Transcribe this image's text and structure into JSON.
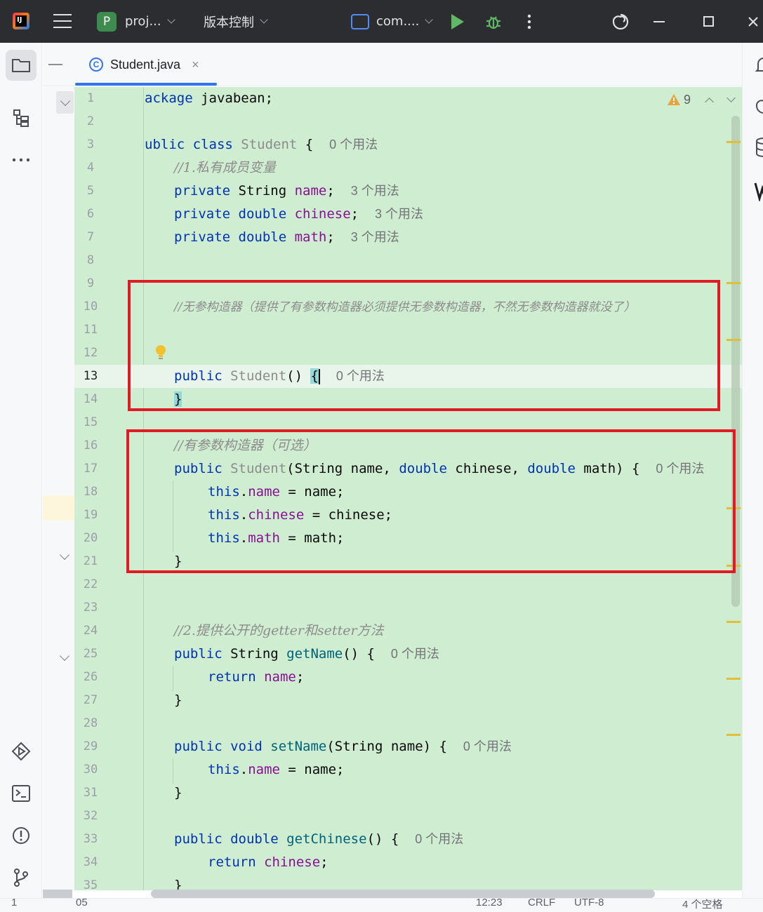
{
  "titlebar": {
    "project_badge": "P",
    "project_name": "proj...",
    "vcs_label": "版本控制",
    "run_config": "com...."
  },
  "tab": {
    "class_glyph": "C",
    "filename": "Student.java",
    "close_glyph": "×"
  },
  "inspections": {
    "warning_count": "9"
  },
  "editor": {
    "lines": [
      "1",
      "2",
      "3",
      "4",
      "5",
      "6",
      "7",
      "8",
      "9",
      "10",
      "11",
      "12",
      "13",
      "14",
      "15",
      "16",
      "17",
      "18",
      "19",
      "20",
      "21",
      "22",
      "23",
      "24",
      "25",
      "26",
      "27",
      "28",
      "29",
      "30",
      "31",
      "32",
      "33",
      "34",
      "35"
    ],
    "current_line": 13,
    "code": {
      "l1_a": "ackage",
      "l1_b": " javabean;",
      "l3_a": "ublic class",
      "l3_b": " Student ",
      "l3_c": "{",
      "l4": "//1.私有成员变量",
      "l5_a": "private",
      "l5_b": " String ",
      "l5_c": "name",
      "l5_d": ";",
      "l6_a": "private double",
      "l6_b": " chinese",
      "l6_c": ";",
      "l7_a": "private double",
      "l7_b": " math",
      "l7_c": ";",
      "l10": "//无参构造器（提供了有参数构造器必须提供无参数构造器，不然无参数构造器就没了）",
      "l13_a": "public",
      "l13_b": " Student",
      "l13_c": "() ",
      "l13_d": "{",
      "l14": "}",
      "l16": "//有参数构造器（可选）",
      "l17_a": "public",
      "l17_b": " Student",
      "l17_c": "(String name, ",
      "l17_d": "double",
      "l17_e": " chinese, ",
      "l17_f": "double",
      "l17_g": " math) {",
      "l18_a": "this",
      "l18_b": ".",
      "l18_c": "name",
      "l18_d": " = name;",
      "l19_a": "this",
      "l19_b": ".",
      "l19_c": "chinese",
      "l19_d": " = chinese;",
      "l20_a": "this",
      "l20_b": ".",
      "l20_c": "math",
      "l20_d": " = math;",
      "l21": "}",
      "l24": "//2.提供公开的getter和setter方法",
      "l25_a": "public",
      "l25_b": " String ",
      "l25_c": "getName",
      "l25_d": "() {",
      "l26_a": "return",
      "l26_b": " name",
      "l26_c": ";",
      "l27": "}",
      "l29_a": "public void",
      "l29_b": " setName",
      "l29_c": "(String name) {",
      "l30_a": "this",
      "l30_b": ".",
      "l30_c": "name",
      "l30_d": " = name;",
      "l31": "}",
      "l33_a": "public double",
      "l33_b": " getChinese",
      "l33_c": "() {",
      "l34_a": "return",
      "l34_b": " chinese",
      "l34_c": ";",
      "l35": "}"
    },
    "usage_hints": {
      "l3": "0 个用法",
      "l5": "3 个用法",
      "l6": "3 个用法",
      "l7": "3 个用法",
      "l13": "0 个用法",
      "l17": "0 个用法",
      "l25": "0 个用法",
      "l29": "0 个用法",
      "l33": "0 个用法"
    }
  },
  "statusbar": {
    "frag_1": "1",
    "frag_2": "05",
    "frag_3": "12:23",
    "frag_4": "CRLF",
    "frag_5": "UTF-8",
    "frag_6": "4 个空格"
  },
  "colors": {
    "editor_bg": "#cfedd0",
    "keyword": "#0033b3",
    "field": "#871094",
    "method": "#00627a",
    "annotation_box": "#e01b24",
    "accent": "#3574f0"
  }
}
